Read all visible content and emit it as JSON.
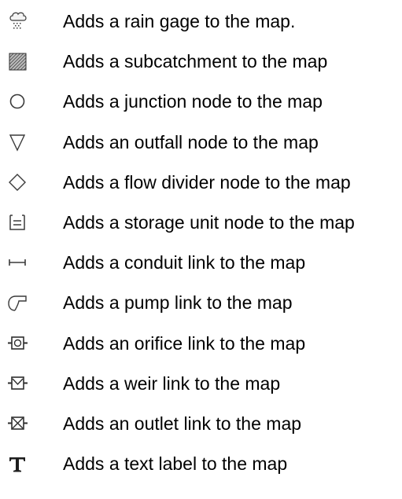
{
  "items": [
    {
      "icon": "rain-gage-icon",
      "label": "Adds a rain gage to the map."
    },
    {
      "icon": "subcatchment-icon",
      "label": "Adds a subcatchment to the map"
    },
    {
      "icon": "junction-node-icon",
      "label": "Adds a junction node to the map"
    },
    {
      "icon": "outfall-node-icon",
      "label": "Adds an outfall node to the map"
    },
    {
      "icon": "flow-divider-icon",
      "label": "Adds a flow divider node to the map"
    },
    {
      "icon": "storage-unit-icon",
      "label": "Adds a storage unit node to the map"
    },
    {
      "icon": "conduit-link-icon",
      "label": "Adds a conduit link to the map"
    },
    {
      "icon": "pump-link-icon",
      "label": "Adds a pump link to the map"
    },
    {
      "icon": "orifice-link-icon",
      "label": "Adds an orifice link to the map"
    },
    {
      "icon": "weir-link-icon",
      "label": "Adds a weir link to the map"
    },
    {
      "icon": "outlet-link-icon",
      "label": "Adds an outlet link to the map"
    },
    {
      "icon": "text-label-icon",
      "label": "Adds a text label to the map"
    }
  ]
}
